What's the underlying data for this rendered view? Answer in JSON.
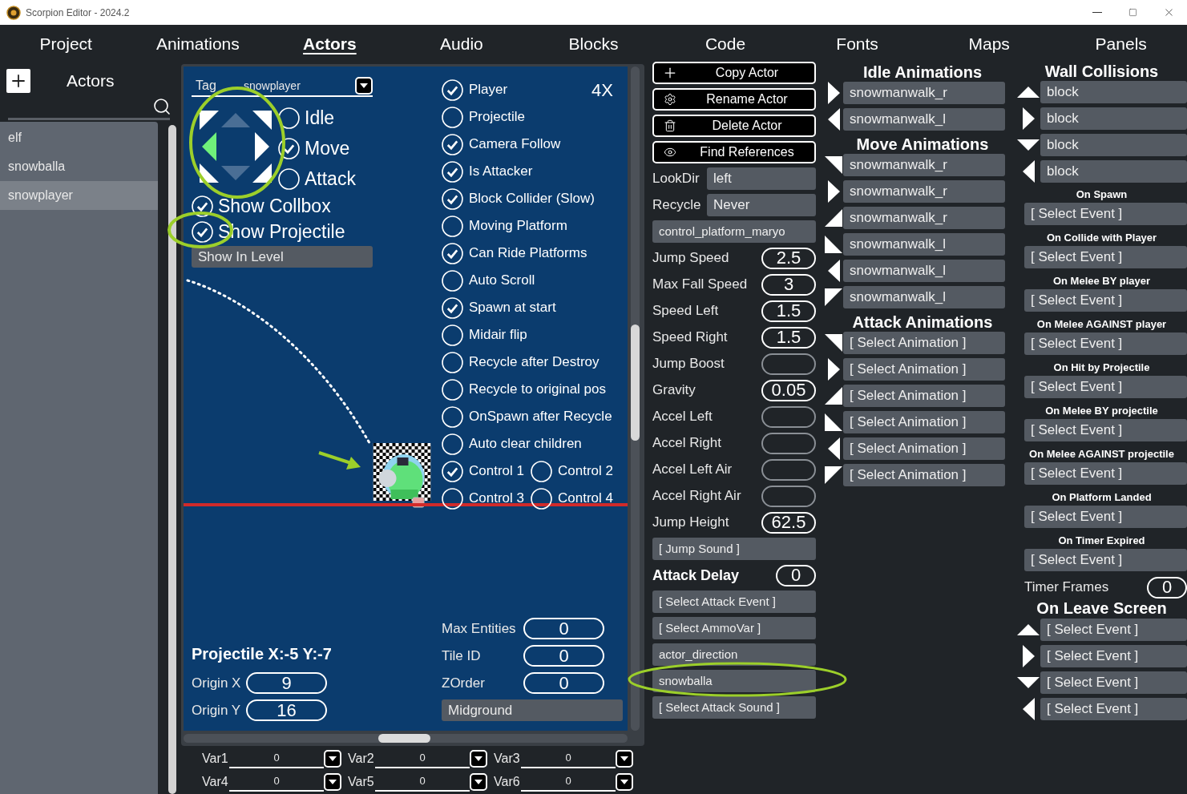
{
  "window": {
    "title": "Scorpion Editor - 2024.2"
  },
  "menu": [
    {
      "label": "Project",
      "selected": false
    },
    {
      "label": "Animations",
      "selected": false
    },
    {
      "label": "Actors",
      "selected": true
    },
    {
      "label": "Audio",
      "selected": false
    },
    {
      "label": "Blocks",
      "selected": false
    },
    {
      "label": "Code",
      "selected": false
    },
    {
      "label": "Fonts",
      "selected": false
    },
    {
      "label": "Maps",
      "selected": false
    },
    {
      "label": "Panels",
      "selected": false
    }
  ],
  "sidebar": {
    "title": "Actors",
    "items": [
      {
        "label": "elf",
        "selected": false
      },
      {
        "label": "snowballa",
        "selected": false
      },
      {
        "label": "snowplayer",
        "selected": true
      }
    ]
  },
  "editor": {
    "tag_label": "Tag",
    "tag_value": "snowplayer",
    "zoom": "4X",
    "directions": [
      {
        "kind": "up-left",
        "selected": false,
        "disabled": false
      },
      {
        "kind": "up",
        "disabled": true
      },
      {
        "kind": "up-right",
        "selected": false,
        "disabled": false
      },
      {
        "kind": "left",
        "selected": true,
        "disabled": false
      },
      {
        "kind": "center"
      },
      {
        "kind": "right",
        "selected": false,
        "disabled": false
      },
      {
        "kind": "down-left",
        "selected": false,
        "disabled": false
      },
      {
        "kind": "down",
        "disabled": true
      },
      {
        "kind": "down-right",
        "selected": false,
        "disabled": false
      }
    ],
    "states": [
      {
        "label": "Idle",
        "selected": false
      },
      {
        "label": "Move",
        "selected": true
      },
      {
        "label": "Attack",
        "selected": false
      }
    ],
    "toggles": [
      {
        "label": "Show Collbox",
        "checked": true
      },
      {
        "label": "Show Projectile",
        "checked": true
      }
    ],
    "layer_toggle": "Show In Level",
    "flag_rows": [
      [
        {
          "label": "Player",
          "checked": true
        }
      ],
      [
        {
          "label": "Projectile",
          "checked": false
        }
      ],
      [
        {
          "label": "Camera Follow",
          "checked": true
        }
      ],
      [
        {
          "label": "Is Attacker",
          "checked": true
        }
      ],
      [
        {
          "label": "Block Collider (Slow)",
          "checked": true
        }
      ],
      [
        {
          "label": "Moving Platform",
          "checked": false
        }
      ],
      [
        {
          "label": "Can Ride Platforms",
          "checked": true
        }
      ],
      [
        {
          "label": "Auto Scroll",
          "checked": false
        }
      ],
      [
        {
          "label": "Spawn at start",
          "checked": true
        }
      ],
      [
        {
          "label": "Midair flip",
          "checked": false
        }
      ],
      [
        {
          "label": "Recycle after Destroy",
          "checked": false
        }
      ],
      [
        {
          "label": "Recycle to original pos",
          "checked": false
        }
      ],
      [
        {
          "label": "OnSpawn after Recycle",
          "checked": false
        }
      ],
      [
        {
          "label": "Auto clear children",
          "checked": false
        }
      ],
      [
        {
          "label": "Control 1",
          "checked": true
        },
        {
          "label": "Control 2",
          "checked": false
        }
      ],
      [
        {
          "label": "Control 3",
          "checked": false
        },
        {
          "label": "Control 4",
          "checked": false
        }
      ]
    ],
    "projectile_label": "Projectile X:-5 Y:-7",
    "origin": [
      {
        "label": "Origin X",
        "value": "9"
      },
      {
        "label": "Origin Y",
        "value": "16"
      }
    ],
    "properties": [
      {
        "label": "Max Entities",
        "value": "0"
      },
      {
        "label": "Tile ID",
        "value": "0"
      },
      {
        "label": "ZOrder",
        "value": "0"
      }
    ],
    "layer": "Midground"
  },
  "variables": [
    {
      "label": "Var1",
      "value": "0"
    },
    {
      "label": "Var2",
      "value": "0"
    },
    {
      "label": "Var3",
      "value": "0"
    },
    {
      "label": "Var4",
      "value": "0"
    },
    {
      "label": "Var5",
      "value": "0"
    },
    {
      "label": "Var6",
      "value": "0"
    }
  ],
  "actor_panel": [
    {
      "kind": "button",
      "label": "Copy Actor"
    },
    {
      "kind": "button",
      "label": "Rename Actor"
    },
    {
      "kind": "button",
      "label": "Delete Actor"
    },
    {
      "kind": "button",
      "label": "Find References"
    },
    {
      "kind": "labeled-select",
      "label": "LookDir",
      "value": "left"
    },
    {
      "kind": "labeled-select",
      "label": "Recycle",
      "value": "Never"
    },
    {
      "kind": "select",
      "value": "control_platform_maryo"
    },
    {
      "kind": "number",
      "label": "Jump Speed",
      "value": "2.5"
    },
    {
      "kind": "number",
      "label": "Max Fall Speed",
      "value": "3"
    },
    {
      "kind": "number",
      "label": "Speed Left",
      "value": "1.5"
    },
    {
      "kind": "number",
      "label": "Speed Right",
      "value": "1.5"
    },
    {
      "kind": "number",
      "label": "Jump Boost"
    },
    {
      "kind": "number",
      "label": "Gravity",
      "value": "0.05"
    },
    {
      "kind": "number",
      "label": "Accel Left"
    },
    {
      "kind": "number",
      "label": "Accel Right"
    },
    {
      "kind": "number",
      "label": "Accel Left Air"
    },
    {
      "kind": "number",
      "label": "Accel Right Air"
    },
    {
      "kind": "number",
      "label": "Jump Height",
      "value": "62.5"
    },
    {
      "kind": "select",
      "value": "[ Jump Sound ]"
    },
    {
      "kind": "heading-number",
      "label": "Attack Delay",
      "value": "0"
    },
    {
      "kind": "select",
      "value": "[ Select Attack Event ]"
    },
    {
      "kind": "select",
      "value": "[ Select AmmoVar ]"
    },
    {
      "kind": "select",
      "value": "actor_direction"
    },
    {
      "kind": "select",
      "value": "snowballa"
    },
    {
      "kind": "select",
      "value": "[ Select Attack Sound ]"
    }
  ],
  "animations": [
    {
      "title": "Idle Animations",
      "items": [
        {
          "kind": "right",
          "value": "snowmanwalk_r"
        },
        {
          "kind": "left",
          "value": "snowmanwalk_l"
        }
      ]
    },
    {
      "title": "Move Animations",
      "items": [
        {
          "kind": "up-right",
          "value": "snowmanwalk_r"
        },
        {
          "kind": "right",
          "value": "snowmanwalk_r"
        },
        {
          "kind": "down-right",
          "value": "snowmanwalk_r"
        },
        {
          "kind": "down-left",
          "value": "snowmanwalk_l"
        },
        {
          "kind": "left",
          "value": "snowmanwalk_l"
        },
        {
          "kind": "up-left",
          "value": "snowmanwalk_l"
        }
      ]
    },
    {
      "title": "Attack Animations",
      "items": [
        {
          "kind": "up-right",
          "value": "[ Select Animation ]"
        },
        {
          "kind": "right",
          "value": "[ Select Animation ]"
        },
        {
          "kind": "down-right",
          "value": "[ Select Animation ]"
        },
        {
          "kind": "down-left",
          "value": "[ Select Animation ]"
        },
        {
          "kind": "left",
          "value": "[ Select Animation ]"
        },
        {
          "kind": "up-left",
          "value": "[ Select Animation ]"
        }
      ]
    }
  ],
  "events": {
    "title": "Wall Collisions",
    "walls": [
      {
        "kind": "up",
        "value": "block"
      },
      {
        "kind": "right",
        "value": "block"
      },
      {
        "kind": "down",
        "value": "block"
      },
      {
        "kind": "left",
        "value": "block"
      }
    ],
    "handlers": [
      {
        "label": "On Spawn",
        "value": "[ Select Event ]"
      },
      {
        "label": "On Collide with Player",
        "value": "[ Select Event ]"
      },
      {
        "label": "On Melee BY player",
        "value": "[ Select Event ]"
      },
      {
        "label": "On Melee AGAINST player",
        "value": "[ Select Event ]"
      },
      {
        "label": "On Hit by Projectile",
        "value": "[ Select Event ]"
      },
      {
        "label": "On Melee BY projectile",
        "value": "[ Select Event ]"
      },
      {
        "label": "On Melee AGAINST projectile",
        "value": "[ Select Event ]"
      },
      {
        "label": "On Platform Landed",
        "value": "[ Select Event ]"
      },
      {
        "label": "On Timer Expired",
        "value": "[ Select Event ]"
      }
    ],
    "timer": {
      "label": "Timer Frames",
      "value": "0"
    },
    "leave_title": "On Leave Screen",
    "leave": [
      {
        "kind": "up",
        "value": "[ Select Event ]"
      },
      {
        "kind": "right",
        "value": "[ Select Event ]"
      },
      {
        "kind": "down",
        "value": "[ Select Event ]"
      },
      {
        "kind": "left",
        "value": "[ Select Event ]"
      }
    ]
  }
}
